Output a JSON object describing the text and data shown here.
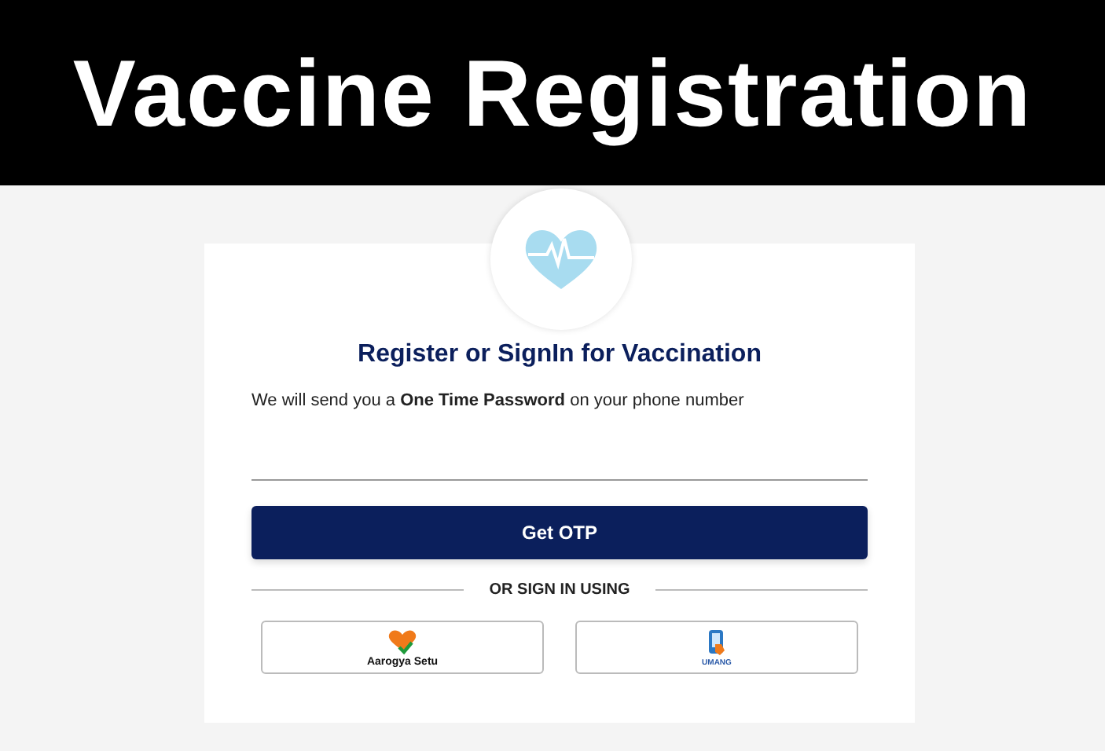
{
  "banner": {
    "title": "Vaccine Registration"
  },
  "card": {
    "title": "Register or SignIn for Vaccination",
    "subtitle": "We will send you a **One Time Password** on your phone number",
    "submit": "Get OTP",
    "divider": "OR SIGN IN USING",
    "providers": [
      {
        "kind": "heart",
        "label": "Aarogya Setu"
      },
      {
        "kind": "phone",
        "label": "UMANG"
      }
    ]
  }
}
